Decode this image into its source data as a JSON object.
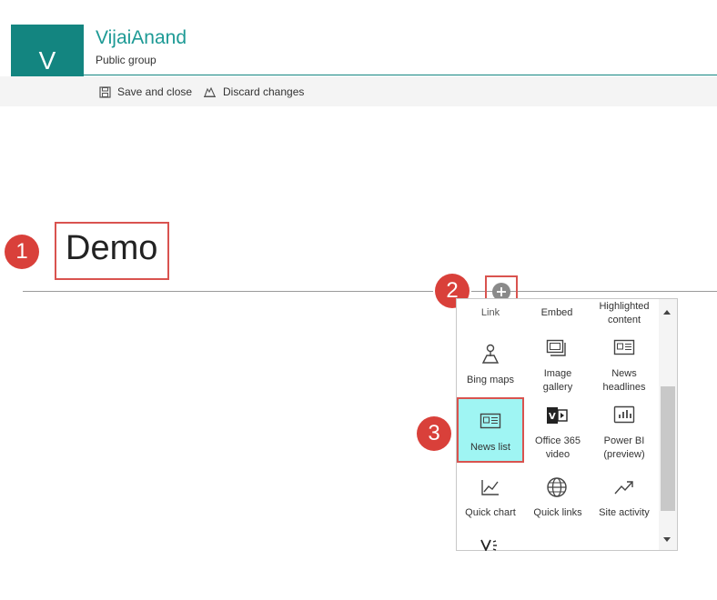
{
  "header": {
    "logo_letter": "V",
    "site_title": "VijaiAnand",
    "site_subtitle": "Public group",
    "commands": {
      "save": "Save and close",
      "discard": "Discard changes"
    }
  },
  "page": {
    "title": "Demo"
  },
  "steps": [
    "1",
    "2",
    "3"
  ],
  "toolbox": {
    "top_row": [
      "Link",
      "Embed",
      "Highlighted content"
    ],
    "tiles": [
      {
        "label": "Bing maps",
        "icon": "map-pin-icon"
      },
      {
        "label": "Image gallery",
        "icon": "image-gallery-icon"
      },
      {
        "label": "News headlines",
        "icon": "news-headlines-icon"
      },
      {
        "label": "News list",
        "icon": "news-list-icon",
        "highlighted": true
      },
      {
        "label": "Office 365 video",
        "icon": "office-video-icon"
      },
      {
        "label": "Power BI (preview)",
        "icon": "power-bi-icon"
      },
      {
        "label": "Quick chart",
        "icon": "line-chart-icon"
      },
      {
        "label": "Quick links",
        "icon": "globe-icon"
      },
      {
        "label": "Site activity",
        "icon": "trend-arrow-icon"
      }
    ]
  },
  "colors": {
    "brand": "#138580",
    "highlight_tile": "#9ff5f3",
    "callout_red": "#d9403a"
  }
}
